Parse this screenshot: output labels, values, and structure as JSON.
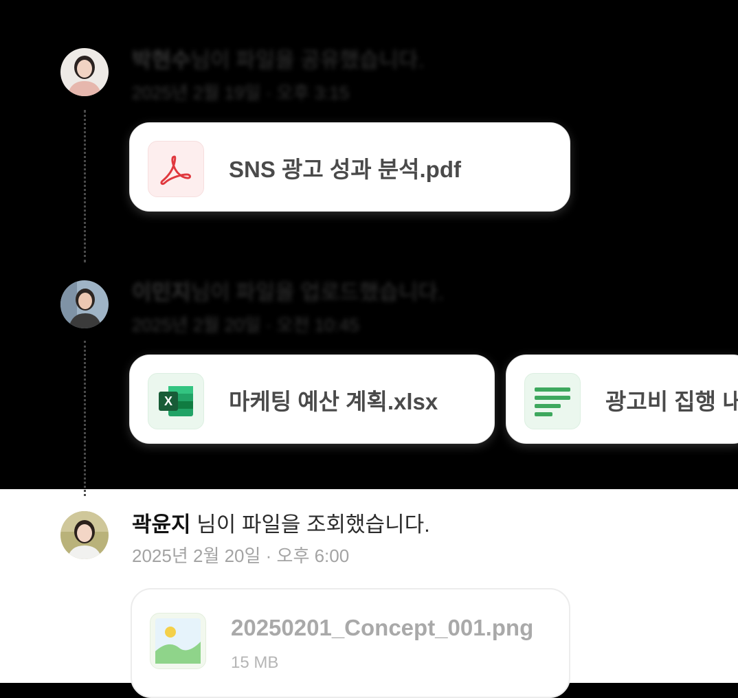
{
  "events": [
    {
      "actor": "박현수",
      "action": "님이 파일을 공유했습니다.",
      "meta": "2025년 2월 19일 · 오후 3:15",
      "files": [
        {
          "name": "SNS 광고 성과 분석.pdf",
          "icon": "pdf-icon",
          "color": "#e0383e"
        }
      ]
    },
    {
      "actor": "이민지",
      "action": "님이 파일을 업로드했습니다.",
      "meta": "2025년 2월 20일 · 오전 10:45",
      "files": [
        {
          "name": "마케팅 예산 계획.xlsx",
          "icon": "excel-icon",
          "color": "#1d7a45"
        },
        {
          "name": "광고비 집행 내",
          "icon": "document-lines-icon",
          "color": "#3ea85e"
        }
      ]
    },
    {
      "actor": "곽윤지",
      "action": " 님이 파일을 조회했습니다.",
      "meta": "2025년 2월 20일 · 오후 6:00",
      "files": [
        {
          "name": "20250201_Concept_001.png",
          "size": "15 MB",
          "icon": "image-icon",
          "color": "#8fd48a"
        }
      ]
    }
  ]
}
